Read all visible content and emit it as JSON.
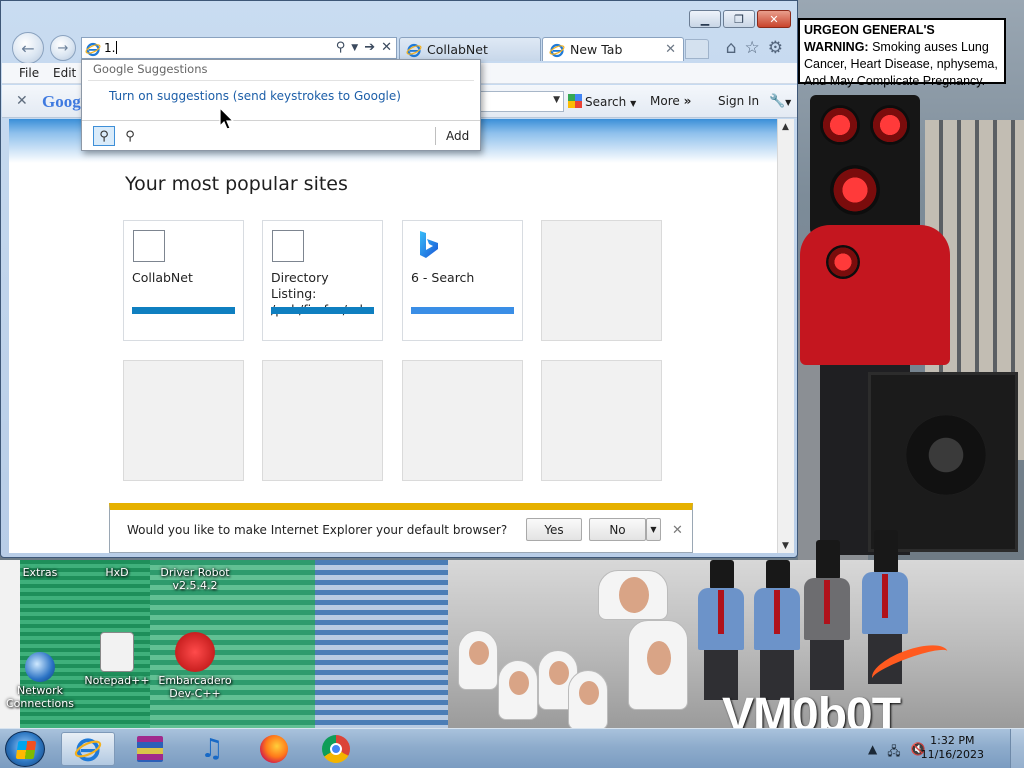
{
  "desktop": {
    "warning_sign": {
      "bold": "URGEON GENERAL'S WARNING:",
      "text": "Smoking auses Lung Cancer, Heart Disease, nphysema, And May Complicate Pregnancy."
    },
    "logo_text": "VM0b0T",
    "icons": [
      {
        "label": "Extras"
      },
      {
        "label": "HxD"
      },
      {
        "label": "Driver Robot v2.5.4.2"
      },
      {
        "label": "Network Connections"
      },
      {
        "label": "Notepad++"
      },
      {
        "label": "Embarcadero Dev-C++"
      }
    ]
  },
  "browser": {
    "address_value": "1.",
    "tabs": [
      {
        "label": "CollabNet",
        "active": false
      },
      {
        "label": "New Tab",
        "active": true
      }
    ],
    "menu": {
      "file": "File",
      "edit": "Edit"
    },
    "toolbar": {
      "google_logo": "Goog",
      "search_label": "Search",
      "more_label": "More",
      "more_suffix": "»",
      "signin_label": "Sign In"
    },
    "suggestions": {
      "header": "Google Suggestions",
      "link": "Turn on suggestions (send keystrokes to Google)",
      "add_label": "Add"
    },
    "page": {
      "title": "Your most popular sites",
      "tiles": [
        {
          "name": "CollabNet",
          "icon": "blank-favicon",
          "bar_color": "#0f7fc0"
        },
        {
          "name": "Directory Listing: /pub/firefox/rel...",
          "icon": "blank-favicon",
          "bar_color": "#0f7fc0"
        },
        {
          "name": "6 - Search",
          "icon": "bing-icon",
          "bar_color": "#3a8ee6"
        }
      ]
    },
    "notification": {
      "message": "Would you like to make Internet Explorer your default browser?",
      "yes_label": "Yes",
      "no_label": "No"
    }
  },
  "taskbar": {
    "time": "1:32 PM",
    "date": "11/16/2023",
    "pinned": [
      "internet-explorer-icon",
      "winrar-icon",
      "music-icon",
      "firefox-icon",
      "chrome-icon"
    ]
  },
  "colors": {
    "accent_link": "#1c5ea8",
    "notification_bar": "#e6b100",
    "taskbar": "#8eaccc"
  }
}
